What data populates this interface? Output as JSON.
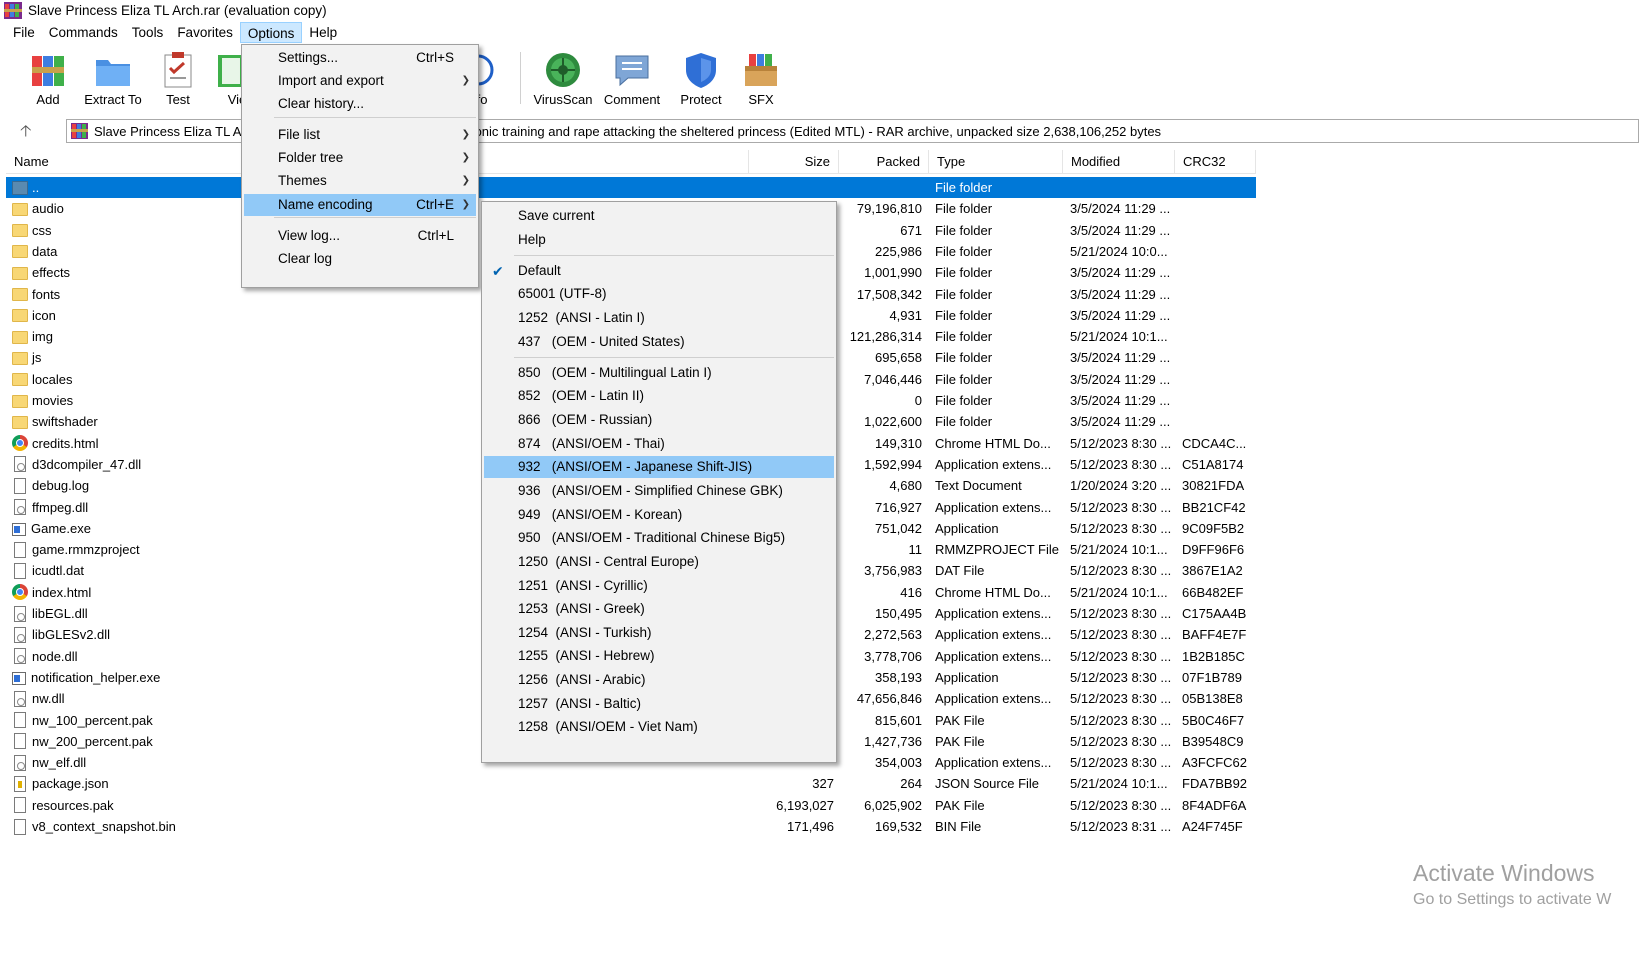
{
  "window": {
    "title": "Slave Princess Eliza TL Arch.rar (evaluation copy)"
  },
  "menubar": [
    "File",
    "Commands",
    "Tools",
    "Favorites",
    "Options",
    "Help"
  ],
  "toolbar": {
    "buttons": [
      "Add",
      "Extract To",
      "Test",
      "Vie",
      "fo",
      "VirusScan",
      "Comment",
      "Protect",
      "SFX"
    ]
  },
  "address": {
    "left_text": "Slave Princess Eliza TL Ar",
    "right_text": "monic training and rape attacking the sheltered princess (Edited MTL) - RAR archive, unpacked size 2,638,106,252 bytes"
  },
  "columns": {
    "name": "Name",
    "size": "Size",
    "packed": "Packed",
    "type": "Type",
    "modified": "Modified",
    "crc": "CRC32"
  },
  "rows": [
    {
      "icon": "up",
      "name": "..",
      "size": "",
      "packed": "",
      "type": "File folder",
      "modified": "",
      "crc": ""
    },
    {
      "icon": "folder",
      "name": "audio",
      "size": "",
      "packed": "79,196,810",
      "type": "File folder",
      "modified": "3/5/2024 11:29 ...",
      "crc": ""
    },
    {
      "icon": "folder",
      "name": "css",
      "size": "",
      "packed": "671",
      "type": "File folder",
      "modified": "3/5/2024 11:29 ...",
      "crc": ""
    },
    {
      "icon": "folder",
      "name": "data",
      "size": "",
      "packed": "225,986",
      "type": "File folder",
      "modified": "5/21/2024 10:0...",
      "crc": ""
    },
    {
      "icon": "folder",
      "name": "effects",
      "size": "",
      "packed": "1,001,990",
      "type": "File folder",
      "modified": "3/5/2024 11:29 ...",
      "crc": ""
    },
    {
      "icon": "folder",
      "name": "fonts",
      "size": "",
      "packed": "17,508,342",
      "type": "File folder",
      "modified": "3/5/2024 11:29 ...",
      "crc": ""
    },
    {
      "icon": "folder",
      "name": "icon",
      "size": "",
      "packed": "4,931",
      "type": "File folder",
      "modified": "3/5/2024 11:29 ...",
      "crc": ""
    },
    {
      "icon": "folder",
      "name": "img",
      "size": "",
      "packed": "121,286,314",
      "type": "File folder",
      "modified": "5/21/2024 10:1...",
      "crc": ""
    },
    {
      "icon": "folder",
      "name": "js",
      "size": "",
      "packed": "695,658",
      "type": "File folder",
      "modified": "3/5/2024 11:29 ...",
      "crc": ""
    },
    {
      "icon": "folder",
      "name": "locales",
      "size": "",
      "packed": "7,046,446",
      "type": "File folder",
      "modified": "3/5/2024 11:29 ...",
      "crc": ""
    },
    {
      "icon": "folder",
      "name": "movies",
      "size": "",
      "packed": "0",
      "type": "File folder",
      "modified": "3/5/2024 11:29 ...",
      "crc": ""
    },
    {
      "icon": "folder",
      "name": "swiftshader",
      "size": "",
      "packed": "1,022,600",
      "type": "File folder",
      "modified": "3/5/2024 11:29 ...",
      "crc": ""
    },
    {
      "icon": "chrome",
      "name": "credits.html",
      "size": "",
      "packed": "149,310",
      "type": "Chrome HTML Do...",
      "modified": "5/12/2023 8:30 ...",
      "crc": "CDCA4C..."
    },
    {
      "icon": "dll",
      "name": "d3dcompiler_47.dll",
      "size": "",
      "packed": "1,592,994",
      "type": "Application extens...",
      "modified": "5/12/2023 8:30 ...",
      "crc": "C51A8174"
    },
    {
      "icon": "file",
      "name": "debug.log",
      "size": "",
      "packed": "4,680",
      "type": "Text Document",
      "modified": "1/20/2024 3:20 ...",
      "crc": "30821FDA"
    },
    {
      "icon": "dll",
      "name": "ffmpeg.dll",
      "size": "",
      "packed": "716,927",
      "type": "Application extens...",
      "modified": "5/12/2023 8:30 ...",
      "crc": "BB21CF42"
    },
    {
      "icon": "exe",
      "name": "Game.exe",
      "size": "",
      "packed": "751,042",
      "type": "Application",
      "modified": "5/12/2023 8:30 ...",
      "crc": "9C09F5B2"
    },
    {
      "icon": "file",
      "name": "game.rmmzproject",
      "size": "",
      "packed": "11",
      "type": "RMMZPROJECT File",
      "modified": "5/21/2024 10:1...",
      "crc": "D9FF96F6"
    },
    {
      "icon": "file",
      "name": "icudtl.dat",
      "size": "",
      "packed": "3,756,983",
      "type": "DAT File",
      "modified": "5/12/2023 8:30 ...",
      "crc": "3867E1A2"
    },
    {
      "icon": "chrome",
      "name": "index.html",
      "size": "",
      "packed": "416",
      "type": "Chrome HTML Do...",
      "modified": "5/21/2024 10:1...",
      "crc": "66B482EF"
    },
    {
      "icon": "dll",
      "name": "libEGL.dll",
      "size": "",
      "packed": "150,495",
      "type": "Application extens...",
      "modified": "5/12/2023 8:30 ...",
      "crc": "C175AA4B"
    },
    {
      "icon": "dll",
      "name": "libGLESv2.dll",
      "size": "",
      "packed": "2,272,563",
      "type": "Application extens...",
      "modified": "5/12/2023 8:30 ...",
      "crc": "BAFF4E7F"
    },
    {
      "icon": "dll",
      "name": "node.dll",
      "size": "",
      "packed": "3,778,706",
      "type": "Application extens...",
      "modified": "5/12/2023 8:30 ...",
      "crc": "1B2B185C"
    },
    {
      "icon": "exe",
      "name": "notification_helper.exe",
      "size": "",
      "packed": "358,193",
      "type": "Application",
      "modified": "5/12/2023 8:30 ...",
      "crc": "07F1B789"
    },
    {
      "icon": "dll",
      "name": "nw.dll",
      "size": "",
      "packed": "47,656,846",
      "type": "Application extens...",
      "modified": "5/12/2023 8:30 ...",
      "crc": "05B138E8"
    },
    {
      "icon": "file",
      "name": "nw_100_percent.pak",
      "size": "",
      "packed": "815,601",
      "type": "PAK File",
      "modified": "5/12/2023 8:30 ...",
      "crc": "5B0C46F7"
    },
    {
      "icon": "file",
      "name": "nw_200_percent.pak",
      "size": "",
      "packed": "1,427,736",
      "type": "PAK File",
      "modified": "5/12/2023 8:30 ...",
      "crc": "B39548C9"
    },
    {
      "icon": "dll",
      "name": "nw_elf.dll",
      "size": "",
      "packed": "354,003",
      "type": "Application extens...",
      "modified": "5/12/2023 8:30 ...",
      "crc": "A3FCFC62"
    },
    {
      "icon": "json",
      "name": "package.json",
      "size": "327",
      "packed": "264",
      "type": "JSON Source File",
      "modified": "5/21/2024 10:1...",
      "crc": "FDA7BB92"
    },
    {
      "icon": "file",
      "name": "resources.pak",
      "size": "6,193,027",
      "packed": "6,025,902",
      "type": "PAK File",
      "modified": "5/12/2023 8:30 ...",
      "crc": "8F4ADF6A"
    },
    {
      "icon": "file",
      "name": "v8_context_snapshot.bin",
      "size": "171,496",
      "packed": "169,532",
      "type": "BIN File",
      "modified": "5/12/2023 8:31 ...",
      "crc": "A24F745F"
    }
  ],
  "options_menu": [
    {
      "label": "Settings...",
      "shortcut": "Ctrl+S",
      "submenu": false
    },
    {
      "label": "Import and export",
      "shortcut": "",
      "submenu": true
    },
    {
      "label": "Clear history...",
      "shortcut": "",
      "submenu": false
    },
    {
      "label": "File list",
      "shortcut": "",
      "submenu": true
    },
    {
      "label": "Folder tree",
      "shortcut": "",
      "submenu": true
    },
    {
      "label": "Themes",
      "shortcut": "",
      "submenu": true
    },
    {
      "label": "Name encoding",
      "shortcut": "Ctrl+E",
      "submenu": true,
      "highlighted": true
    },
    {
      "label": "View log...",
      "shortcut": "Ctrl+L",
      "submenu": false
    },
    {
      "label": "Clear log",
      "shortcut": "",
      "submenu": false
    }
  ],
  "encoding_menu": [
    {
      "label": "Save current"
    },
    {
      "label": "Help"
    },
    {
      "label": "Default",
      "checked": true
    },
    {
      "label": "65001 (UTF-8)"
    },
    {
      "label": "1252  (ANSI - Latin I)"
    },
    {
      "label": "437   (OEM - United States)"
    },
    {
      "label": "850   (OEM - Multilingual Latin I)"
    },
    {
      "label": "852   (OEM - Latin II)"
    },
    {
      "label": "866   (OEM - Russian)"
    },
    {
      "label": "874   (ANSI/OEM - Thai)"
    },
    {
      "label": "932   (ANSI/OEM - Japanese Shift-JIS)",
      "highlighted": true
    },
    {
      "label": "936   (ANSI/OEM - Simplified Chinese GBK)"
    },
    {
      "label": "949   (ANSI/OEM - Korean)"
    },
    {
      "label": "950   (ANSI/OEM - Traditional Chinese Big5)"
    },
    {
      "label": "1250  (ANSI - Central Europe)"
    },
    {
      "label": "1251  (ANSI - Cyrillic)"
    },
    {
      "label": "1253  (ANSI - Greek)"
    },
    {
      "label": "1254  (ANSI - Turkish)"
    },
    {
      "label": "1255  (ANSI - Hebrew)"
    },
    {
      "label": "1256  (ANSI - Arabic)"
    },
    {
      "label": "1257  (ANSI - Baltic)"
    },
    {
      "label": "1258  (ANSI/OEM - Viet Nam)"
    }
  ],
  "watermark": {
    "line1": "Activate Windows",
    "line2": "Go to Settings to activate W"
  }
}
